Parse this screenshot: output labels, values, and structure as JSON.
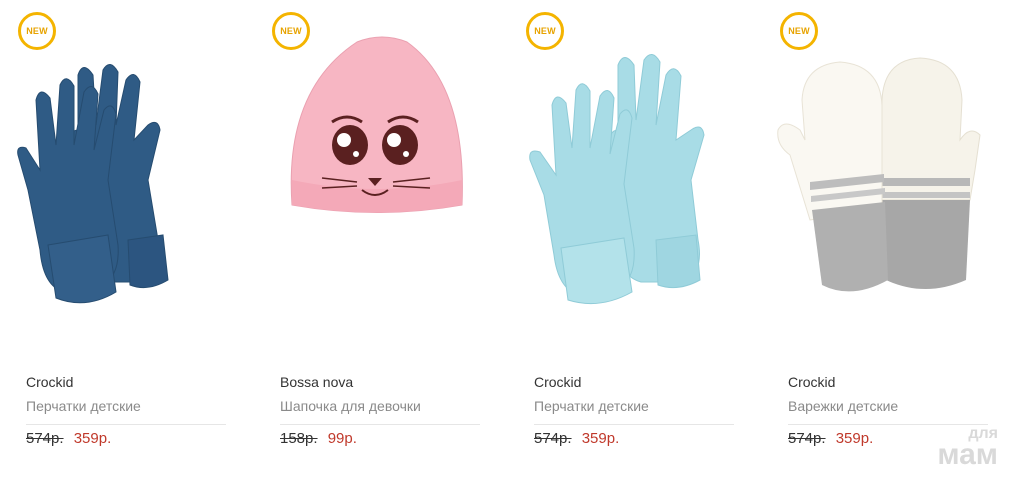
{
  "products": [
    {
      "badge": "NEW",
      "brand": "Crockid",
      "name": "Перчатки детские",
      "old_price": "574р.",
      "new_price": "359р.",
      "image": "dark-blue-gloves-icon"
    },
    {
      "badge": "NEW",
      "brand": "Bossa nova",
      "name": "Шапочка для девочки",
      "old_price": "158р.",
      "new_price": "99р.",
      "image": "pink-hat-icon"
    },
    {
      "badge": "NEW",
      "brand": "Crockid",
      "name": "Перчатки детские",
      "old_price": "574р.",
      "new_price": "359р.",
      "image": "light-blue-gloves-icon"
    },
    {
      "badge": "NEW",
      "brand": "Crockid",
      "name": "Варежки детские",
      "old_price": "574р.",
      "new_price": "359р.",
      "image": "white-mittens-icon"
    }
  ],
  "watermark": {
    "line1": "для",
    "line2": "мам"
  },
  "colors": {
    "badge": "#f4b400",
    "sale_price": "#c0392b",
    "old_price": "#333333"
  }
}
